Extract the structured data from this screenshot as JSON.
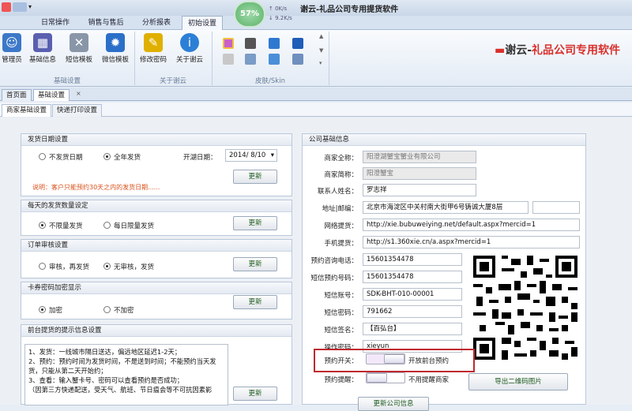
{
  "window": {
    "title": "谢云-礼品公司专用提货软件"
  },
  "gauge": {
    "percent_label": "57%",
    "up_speed": "0K/s",
    "down_speed": "9.2K/s"
  },
  "ribbon": {
    "tabs": [
      "日常操作",
      "销售与售后",
      "分析报表",
      "初始设置"
    ],
    "active_tab": "初始设置",
    "buttons": [
      {
        "label": "管理员",
        "icon": "admin-icon"
      },
      {
        "label": "基础信息",
        "icon": "base-info-icon"
      },
      {
        "label": "短信模板",
        "icon": "sms-template-icon"
      },
      {
        "label": "微信模板",
        "icon": "wechat-template-icon"
      },
      {
        "label": "修改密码",
        "icon": "change-password-icon"
      },
      {
        "label": "关于谢云",
        "icon": "about-icon"
      }
    ],
    "groups": [
      "基础设置",
      "关于谢云",
      "皮肤/Skin"
    ],
    "brand": {
      "prefix": "谢云-",
      "suffix": "礼品公司专用软件"
    }
  },
  "doc_tabs": [
    "首页面",
    "基础设置"
  ],
  "sub_tabs": [
    "商家基础设置",
    "快递打印设置"
  ],
  "ship_date": {
    "title": "发货日期设置",
    "options": [
      "不发货日期",
      "全年发货"
    ],
    "selected": 1,
    "open_date_label": "开湖日期：",
    "open_date_value": "2014/ 8/10",
    "note": "说明：客户只能预约30天之内的发货日期......",
    "update": "更新"
  },
  "daily_limit": {
    "title": "每天的发货数量设定",
    "options": [
      "不限量发货",
      "每日限量发货"
    ],
    "selected": 0,
    "update": "更新"
  },
  "order_review": {
    "title": "订单审核设置",
    "options": [
      "审核，再发货",
      "无审核，发货"
    ],
    "selected": 1,
    "update": "更新"
  },
  "card_encrypt": {
    "title": "卡券密码加密显示",
    "options": [
      "加密",
      "不加密"
    ],
    "selected": 0,
    "update": "更新"
  },
  "front_tips": {
    "title": "前台提货的提示信息设置",
    "lines": [
      "1、发货：一线城市隔日送达，偏远地区延迟1-2天；",
      "2、预约：预约时间为发货时间，不是送到时间；不能预约当天发货，只能从第二天开始约；",
      "3、查看：输入蟹卡号、密码可以查看预约是否成功；",
      "（因第三方快递配送，受天气、航班、节日瘟会等不可抗因素影"
    ],
    "update": "更新"
  },
  "company": {
    "title": "公司基础信息",
    "fields": [
      {
        "label": "商家全称：",
        "value": "阳澄湖蟹宝蟹业有限公司",
        "readonly": true
      },
      {
        "label": "商家简称：",
        "value": "阳澄蟹宝",
        "readonly": true
      },
      {
        "label": "联系人姓名：",
        "value": "罗志祥",
        "readonly": false
      },
      {
        "label": "地址|邮编：",
        "value": "北京市海淀区中关村南大街甲6号铸诚大厦8层",
        "readonly": false
      },
      {
        "label": "网络提货：",
        "value": "http://xie.bubuweiying.net/default.aspx?mercid=1",
        "readonly": false
      },
      {
        "label": "手机提货：",
        "value": "http://s1.360xie.cn/a.aspx?mercid=1",
        "readonly": false
      },
      {
        "label": "预约咨询电话：",
        "value": "15601354478",
        "readonly": false
      },
      {
        "label": "短信预约号码：",
        "value": "15601354478",
        "readonly": false
      },
      {
        "label": "短信账号：",
        "value": "SDK-BHT-010-00001",
        "readonly": false
      },
      {
        "label": "短信密码：",
        "value": "791662",
        "readonly": false
      },
      {
        "label": "短信签名：",
        "value": "【百弘台】",
        "readonly": false
      },
      {
        "label": "操作密码：",
        "value": "xieyun",
        "readonly": false
      }
    ],
    "booking_switch": {
      "label": "预约开关：",
      "text": "开放前台预约"
    },
    "booking_reminder": {
      "label": "预约提醒：",
      "text": "不用提醒商家"
    },
    "export_qr": "导出二维码图片",
    "update_company": "更新公司信息"
  },
  "colors": {
    "highlight_box": "#c0282e",
    "note": "#d9501b",
    "brand_red": "#d9302c"
  }
}
